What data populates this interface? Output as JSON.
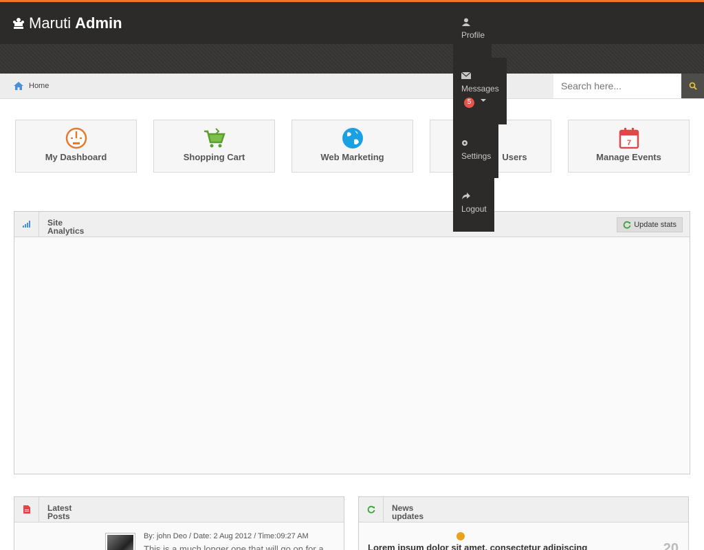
{
  "header": {
    "brand_light": "Maruti",
    "brand_bold": "Admin",
    "accent": "#e8782a"
  },
  "user_nav": {
    "profile": "Profile",
    "messages": "Messages",
    "messages_count": "5",
    "settings": "Settings",
    "logout": "Logout"
  },
  "breadcrumb": {
    "home": "Home"
  },
  "search": {
    "placeholder": "Search here..."
  },
  "tiles": [
    {
      "label": "My Dashboard",
      "icon": "speedometer-icon"
    },
    {
      "label": "Shopping Cart",
      "icon": "cart-icon"
    },
    {
      "label": "Web Marketing",
      "icon": "globe-icon"
    },
    {
      "label": "Users",
      "icon": "users-icon"
    },
    {
      "label": "Manage Events",
      "icon": "calendar-icon"
    }
  ],
  "calendar_day": "7",
  "analytics": {
    "title_line1": "Site",
    "title_line2": "Analytics",
    "update_label": "Update stats"
  },
  "latest_posts": {
    "title_line1": "Latest",
    "title_line2": "Posts",
    "meta": "By: john Deo / Date: 2 Aug 2012 / Time:09:27 AM",
    "text": "This is a much longer one that will go on for a"
  },
  "news": {
    "title_line1": "News",
    "title_line2": "updates",
    "headline": "Lorem ipsum dolor sit amet, consectetur adipiscing",
    "date": "20"
  }
}
